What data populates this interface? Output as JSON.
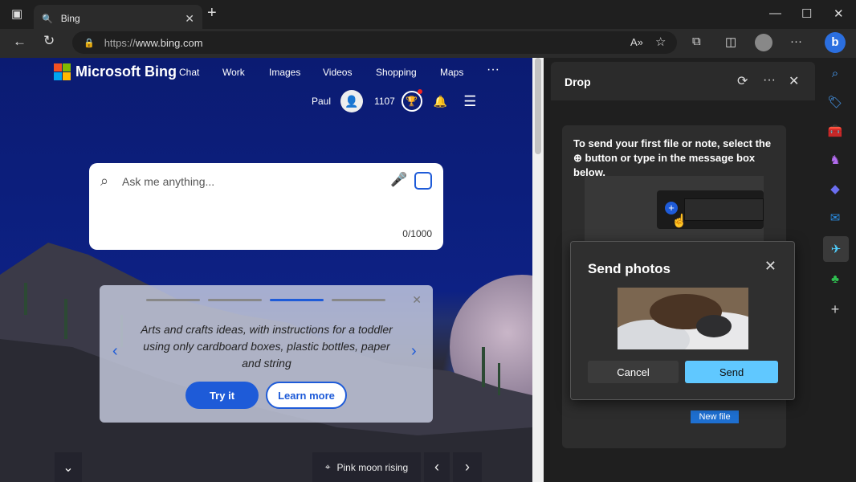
{
  "browser": {
    "tab_title": "Bing",
    "tab_close": "✕",
    "new_tab": "+",
    "url_protocol": "https://",
    "url_host": "www.bing.com",
    "min": "—",
    "max": "☐",
    "close": "✕"
  },
  "bing": {
    "brand": "Microsoft Bing",
    "nav": [
      "Chat",
      "Work",
      "Images",
      "Videos",
      "Shopping",
      "Maps",
      "···"
    ],
    "user_name": "Paul",
    "points": "1107",
    "search_placeholder": "Ask me anything...",
    "char_count": "0/1000",
    "suggestion_text": "Arts and crafts ideas, with instructions for a toddler using only cardboard boxes, plastic bottles, paper and string",
    "try_label": "Try it",
    "learn_label": "Learn more",
    "image_caption": "Pink moon rising",
    "collapse_glyph": "⌄",
    "prev_glyph": "‹",
    "next_glyph": "›"
  },
  "drop": {
    "title": "Drop",
    "instructions": "To send your first file or note, select the ⊕ button or type in the message box below.",
    "new_file_label": "New file"
  },
  "dialog": {
    "title": "Send photos",
    "cancel_label": "Cancel",
    "send_label": "Send"
  },
  "colors": {
    "accent": "#1e5bd8",
    "send_button": "#60c8ff"
  }
}
